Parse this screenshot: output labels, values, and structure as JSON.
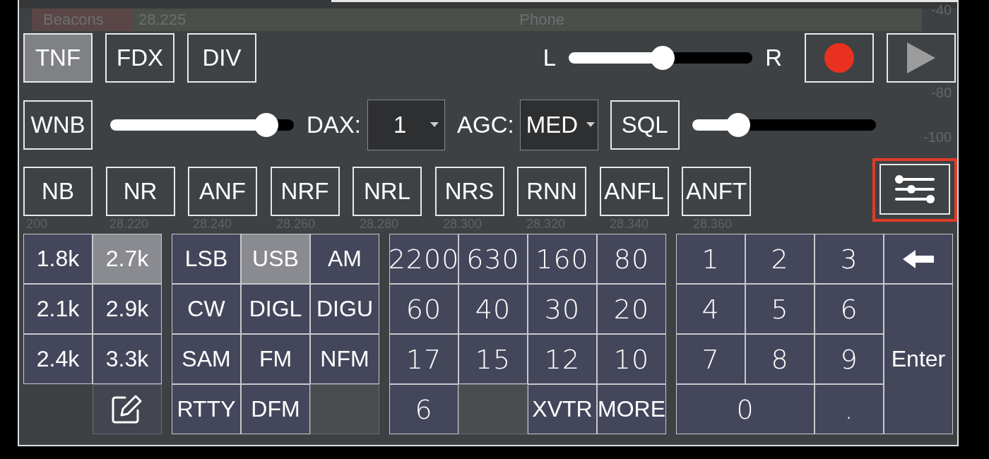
{
  "band_plan": {
    "segments": [
      {
        "label": "Beacons",
        "color": "#5a4646"
      },
      {
        "label": "Phone",
        "color": "#4a5049"
      }
    ],
    "start_frequency": "28.225"
  },
  "db_scale": [
    "-40",
    "-80",
    "-100"
  ],
  "frequency_axis": [
    "200",
    "28.220",
    "28.240",
    "28.260",
    "28.280",
    "28.300",
    "28.320",
    "28.340",
    "28.360"
  ],
  "top_buttons": [
    {
      "label": "TNF",
      "selected": true
    },
    {
      "label": "FDX",
      "selected": false
    },
    {
      "label": "DIV",
      "selected": false
    }
  ],
  "pan": {
    "left_label": "L",
    "right_label": "R",
    "level": 0.51
  },
  "wnb": {
    "label": "WNB",
    "selected": false,
    "level": 0.85
  },
  "dax": {
    "label": "DAX:",
    "value": "1"
  },
  "agc": {
    "label": "AGC:",
    "value": "MED"
  },
  "squelch": {
    "label": "SQL",
    "selected": false,
    "level": 0.25
  },
  "dsp_buttons": [
    {
      "label": "NB",
      "selected": false
    },
    {
      "label": "NR",
      "selected": false
    },
    {
      "label": "ANF",
      "selected": false
    },
    {
      "label": "NRF",
      "selected": false
    },
    {
      "label": "NRL",
      "selected": false
    },
    {
      "label": "NRS",
      "selected": false
    },
    {
      "label": "RNN",
      "selected": false
    },
    {
      "label": "ANFL",
      "selected": false
    },
    {
      "label": "ANFT",
      "selected": false
    }
  ],
  "filter_widths": [
    {
      "kind": "key",
      "label": "1.8k",
      "selected": false
    },
    {
      "kind": "key",
      "label": "2.7k",
      "selected": true
    },
    {
      "kind": "key",
      "label": "2.1k",
      "selected": false
    },
    {
      "kind": "key",
      "label": "2.9k",
      "selected": false
    },
    {
      "kind": "key",
      "label": "2.4k",
      "selected": false
    },
    {
      "kind": "key",
      "label": "3.3k",
      "selected": false
    },
    {
      "kind": "gap"
    },
    {
      "kind": "edit"
    }
  ],
  "modes": [
    {
      "kind": "key",
      "label": "LSB",
      "selected": false
    },
    {
      "kind": "key",
      "label": "USB",
      "selected": true
    },
    {
      "kind": "key",
      "label": "AM",
      "selected": false
    },
    {
      "kind": "key",
      "label": "CW",
      "selected": false
    },
    {
      "kind": "key",
      "label": "DIGL",
      "selected": false
    },
    {
      "kind": "key",
      "label": "DIGU",
      "selected": false
    },
    {
      "kind": "key",
      "label": "SAM",
      "selected": false
    },
    {
      "kind": "key",
      "label": "FM",
      "selected": false
    },
    {
      "kind": "key",
      "label": "NFM",
      "selected": false
    },
    {
      "kind": "key",
      "label": "RTTY",
      "selected": false
    },
    {
      "kind": "key",
      "label": "DFM",
      "selected": false
    },
    {
      "kind": "blank"
    }
  ],
  "bands": [
    {
      "kind": "band",
      "label": "2200"
    },
    {
      "kind": "band",
      "label": "630"
    },
    {
      "kind": "band",
      "label": "160"
    },
    {
      "kind": "band",
      "label": "80"
    },
    {
      "kind": "band",
      "label": "60"
    },
    {
      "kind": "band",
      "label": "40"
    },
    {
      "kind": "band",
      "label": "30"
    },
    {
      "kind": "band",
      "label": "20"
    },
    {
      "kind": "band",
      "label": "17"
    },
    {
      "kind": "band",
      "label": "15"
    },
    {
      "kind": "band",
      "label": "12"
    },
    {
      "kind": "band",
      "label": "10"
    },
    {
      "kind": "band",
      "label": "6"
    },
    {
      "kind": "blank"
    },
    {
      "kind": "key",
      "label": "XVTR"
    },
    {
      "kind": "key",
      "label": "MORE"
    }
  ],
  "keypad": [
    {
      "kind": "band",
      "label": "1"
    },
    {
      "kind": "band",
      "label": "2"
    },
    {
      "kind": "band",
      "label": "3"
    },
    {
      "kind": "backspace"
    },
    {
      "kind": "band",
      "label": "4"
    },
    {
      "kind": "band",
      "label": "5"
    },
    {
      "kind": "band",
      "label": "6"
    },
    {
      "kind": "band",
      "label": "7"
    },
    {
      "kind": "band",
      "label": "8"
    },
    {
      "kind": "band",
      "label": "9"
    },
    {
      "kind": "enter",
      "label": "Enter"
    },
    {
      "kind": "wide",
      "label": "0"
    },
    {
      "kind": "band",
      "label": "."
    }
  ]
}
